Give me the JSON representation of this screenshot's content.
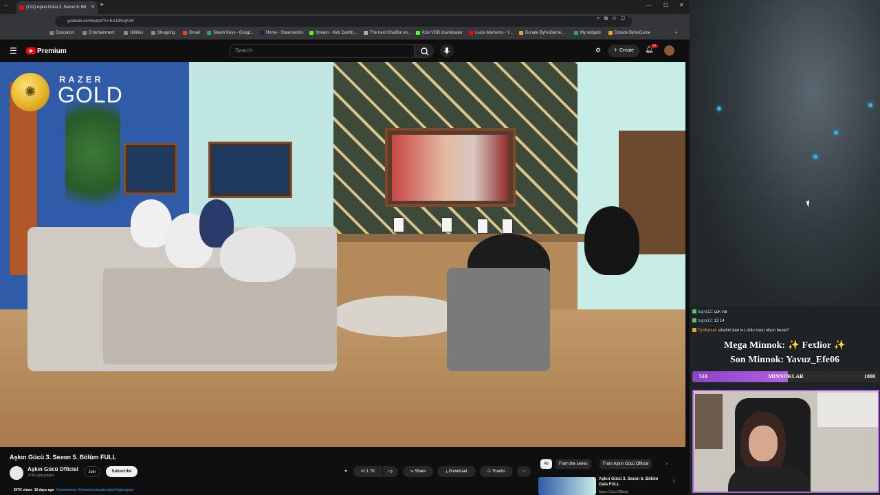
{
  "browser": {
    "tab_title": "(122) Aşkın Gücü 3. Sezon 5. Bö",
    "url": "youtube.com/watch?v=EA18hrqXol4",
    "bookmarks": [
      "Education",
      "Entertainment",
      "Utilities",
      "Shopping",
      "Gmail",
      "Steam Keys - Googl...",
      "Home - Steamworks",
      "Stream - Kick Dashb...",
      "The best ChatBot an...",
      "Kick VOD downloader",
      "Lurox Moments - Y...",
      "Donate ByNoGame...",
      "My widgets",
      "Donate ByNoGame"
    ]
  },
  "youtube": {
    "brand": "Premium",
    "search_placeholder": "Search",
    "create_label": "Create",
    "notif_count": "9+"
  },
  "overlay": {
    "razer": "RAZER",
    "gold": "GOLD"
  },
  "video": {
    "title": "Aşkın Gücü 3. Sezon 5. Bölüm FULL",
    "channel": "Aşkın Gücü Official",
    "subscribers": "772K subscribers",
    "join": "Join",
    "subscribe": "Subscribe",
    "likes": "1.7K",
    "share": "Share",
    "download": "Download",
    "thanks": "Thanks",
    "views": "347K views",
    "age": "10 days ago",
    "hashtags": "#kismetseolur #kismetseoluraşkıngücü #aşkıngücü"
  },
  "chips": [
    "All",
    "From the series",
    "From Aşkın Gücü Official"
  ],
  "recommendation": {
    "title": "Aşkın Gücü 3. Sezon 6. Bölüm Gala FULL",
    "channel": "Aşkın Gücü Official"
  },
  "chat": [
    {
      "user": "tugra12",
      "msg": ": çok var"
    },
    {
      "user": "tugra12",
      "msg": ": 13 14"
    },
    {
      "user": "TynKaisar",
      "msg": ": etrafım karı kız dolu nasıl olsun beste?"
    }
  ],
  "minnok": {
    "mega": "Mega Minnok: ✨ Fexlior ✨",
    "son": "Son Minnok: Yavuz_Efe06"
  },
  "goal": {
    "current": "510",
    "label": "MINNOKLAR",
    "max": "1000",
    "fraction": 0.51
  },
  "colors": {
    "accent_purple": "#b160e0",
    "youtube_red": "#ff0000"
  }
}
